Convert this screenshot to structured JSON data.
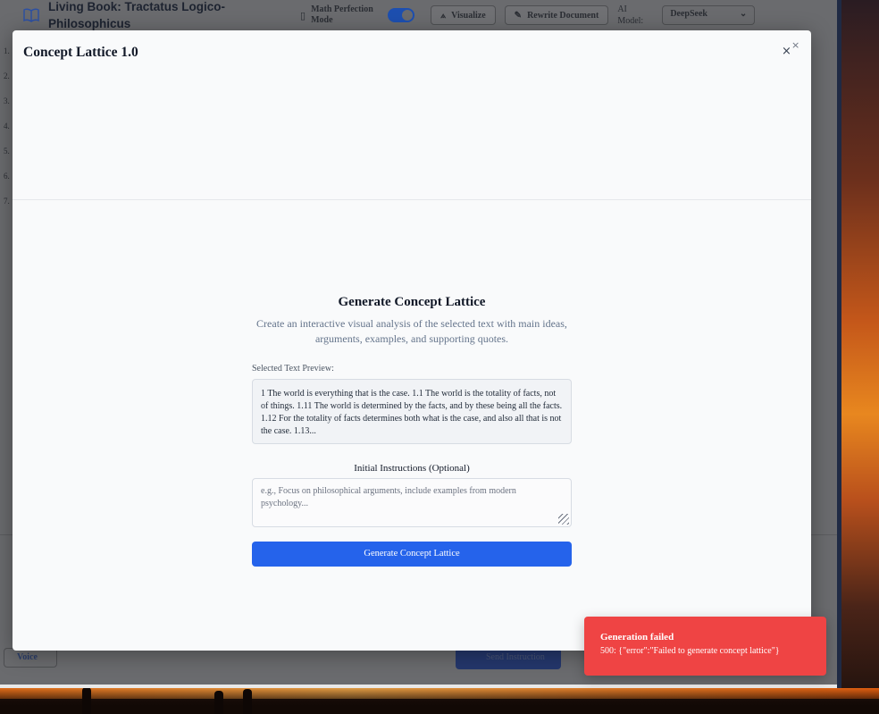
{
  "app": {
    "title": "Living Book: Tractatus Logico-Philosophicus",
    "math_mode_label": "Math Perfection Mode",
    "math_mode_on": true,
    "visualize_label": "Visualize",
    "rewrite_label": "Rewrite Document",
    "ai_model_label": "AI Model:",
    "ai_model_value": "DeepSeek",
    "side_numbers": [
      "1.",
      "2.",
      "3.",
      "4.",
      "5.",
      "6.",
      "7."
    ],
    "voice_label": "Voice",
    "send_label": "Send Instruction"
  },
  "modal": {
    "title": "Concept Lattice 1.0",
    "heading": "Generate Concept Lattice",
    "description": "Create an interactive visual analysis of the selected text with main ideas, arguments, examples, and supporting quotes.",
    "preview_label": "Selected Text Preview:",
    "preview_text": "1 The world is everything that is the case. 1.1 The world is the totality of facts, not of things. 1.11 The world is determined by the facts, and by these being all the facts. 1.12 For the totality of facts determines both what is the case, and also all that is not the case. 1.13...",
    "instructions_label": "Initial Instructions (Optional)",
    "instructions_placeholder": "e.g., Focus on philosophical arguments, include examples from modern psychology...",
    "generate_button": "Generate Concept Lattice"
  },
  "toast": {
    "title": "Generation failed",
    "message": "500: {\"error\":\"Failed to generate concept lattice\"}",
    "color": "#ef4444"
  },
  "colors": {
    "accent": "#2563eb",
    "error": "#ef4444"
  }
}
